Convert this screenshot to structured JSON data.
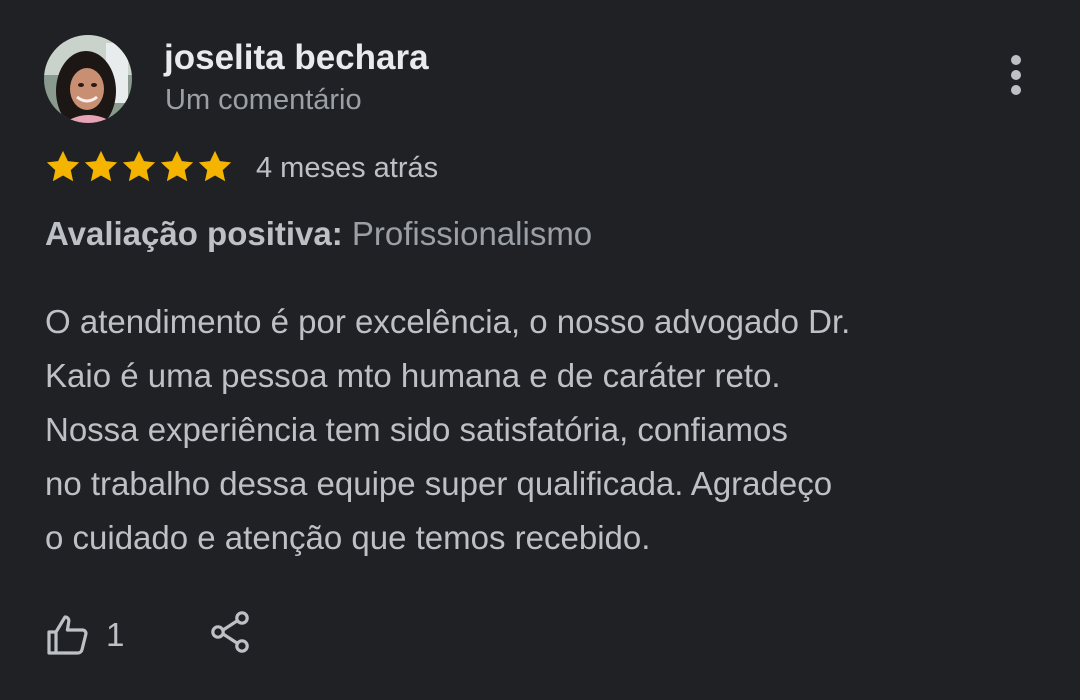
{
  "review": {
    "author_name": "joselita bechara",
    "author_meta": "Um comentário",
    "rating": 5,
    "rating_max": 5,
    "star_color": "#f4b400",
    "date": "4 meses atrás",
    "positive_label": "Avaliação positiva:",
    "positive_value": "Profissionalismo",
    "text_lines": [
      "O atendimento é por excelência, o nosso advogado Dr.",
      "Kaio é uma pessoa mto humana e de caráter reto.",
      "Nossa experiência tem sido satisfatória, confiamos",
      "no trabalho dessa equipe super qualificada. Agradeço",
      "o cuidado e atenção que temos recebido."
    ],
    "like_count": "1"
  },
  "icons": {
    "more": "more-vert-icon",
    "like": "thumb-up-icon",
    "share": "share-icon",
    "star": "star-icon"
  },
  "colors": {
    "background": "#202124",
    "primary_text": "#e8eaed",
    "secondary_text": "#9aa0a6",
    "body_text": "#bdc1c6"
  }
}
